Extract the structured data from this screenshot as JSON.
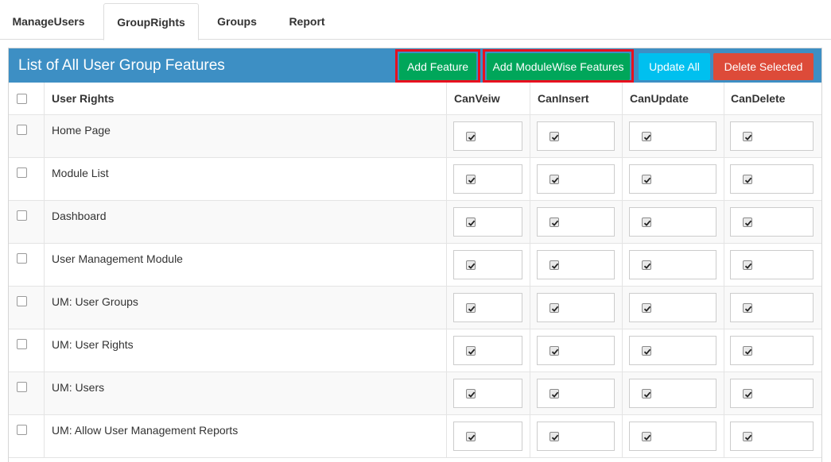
{
  "tabs": [
    {
      "label": "ManageUsers",
      "active": false
    },
    {
      "label": "GroupRights",
      "active": true
    },
    {
      "label": "Groups",
      "active": false
    },
    {
      "label": "Report",
      "active": false
    }
  ],
  "panel": {
    "title": "List of All User Group Features",
    "buttons": {
      "add_feature": "Add Feature",
      "add_modulewise": "Add ModuleWise Features",
      "update_all": "Update All",
      "delete_selected": "Delete Selected"
    }
  },
  "table": {
    "headers": [
      "User Rights",
      "CanVeiw",
      "CanInsert",
      "CanUpdate",
      "CanDelete"
    ],
    "rows": [
      {
        "name": "Home Page",
        "view": true,
        "insert": true,
        "update": true,
        "delete": true
      },
      {
        "name": "Module List",
        "view": true,
        "insert": true,
        "update": true,
        "delete": true
      },
      {
        "name": "Dashboard",
        "view": true,
        "insert": true,
        "update": true,
        "delete": true
      },
      {
        "name": "User Management Module",
        "view": true,
        "insert": true,
        "update": true,
        "delete": true
      },
      {
        "name": "UM: User Groups",
        "view": true,
        "insert": true,
        "update": true,
        "delete": true
      },
      {
        "name": "UM: User Rights",
        "view": true,
        "insert": true,
        "update": true,
        "delete": true
      },
      {
        "name": "UM: Users",
        "view": true,
        "insert": true,
        "update": true,
        "delete": true
      },
      {
        "name": "UM: Allow User Management Reports",
        "view": true,
        "insert": true,
        "update": true,
        "delete": true
      }
    ]
  },
  "colors": {
    "header_bg": "#3d8fc4",
    "green": "#00a65a",
    "cyan": "#00c0ef",
    "red": "#dd4b39",
    "highlight": "#e8101f"
  }
}
